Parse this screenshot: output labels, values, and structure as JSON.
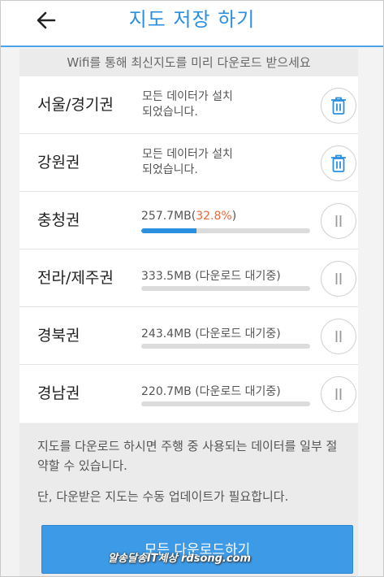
{
  "header": {
    "title": "지도 저장 하기",
    "back_icon": "arrow-left-icon"
  },
  "subtitle": "Wifi를 통해 최신지도를 미리 다운로드 받으세요",
  "regions": [
    {
      "name": "서울/경기권",
      "status_line1": "모든 데이터가 설치",
      "status_line2": "되었습니다.",
      "action_icon": "trash-icon"
    },
    {
      "name": "강원권",
      "status_line1": "모든 데이터가 설치",
      "status_line2": "되었습니다.",
      "action_icon": "trash-icon"
    },
    {
      "name": "충청권",
      "size": "257.7MB",
      "percent": "32.8%",
      "progress": 0.328,
      "action_icon": "pause-icon"
    },
    {
      "name": "전라/제주권",
      "size": "333.5MB",
      "state": "(다운로드 대기중)",
      "progress": 0,
      "action_icon": "pause-icon"
    },
    {
      "name": "경북권",
      "size": "243.4MB",
      "state": "(다운로드 대기중)",
      "progress": 0,
      "action_icon": "pause-icon"
    },
    {
      "name": "경남권",
      "size": "220.7MB",
      "state": "(다운로드 대기중)",
      "progress": 0,
      "action_icon": "pause-icon"
    }
  ],
  "info": {
    "line1": "지도를 다운로드 하시면 주행 중 사용되는 데이터를 일부 절약할 수 있습니다.",
    "line2": "단, 다운받은 지도는 수동 업데이트가 필요합니다."
  },
  "download_all_label": "모든 다운로드하기",
  "watermark": "알송달송IT세상 rdsong.com",
  "colors": {
    "accent": "#2b8fe0",
    "percent": "#e8663a",
    "button": "#3d9ae6"
  }
}
